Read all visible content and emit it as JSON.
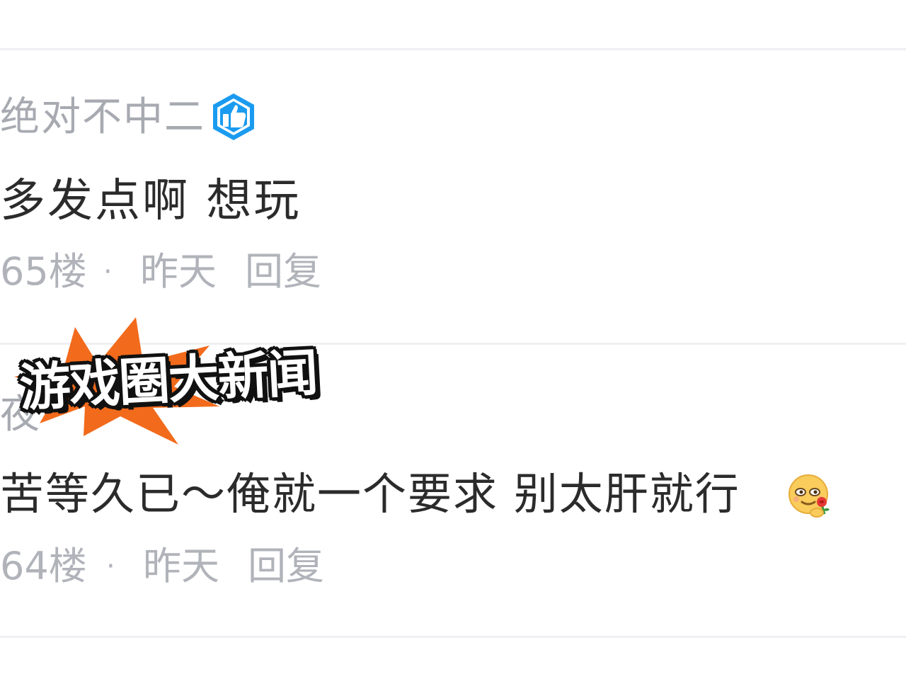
{
  "comments": [
    {
      "username": "绝对不中二",
      "badge_icon": "thumbs-up-badge-icon",
      "badge_color": "#1a9bf0",
      "content": "多发点啊 想玩",
      "floor": "65楼",
      "separator": "·",
      "time": "昨天",
      "reply_label": "回复"
    },
    {
      "username": "夜",
      "content": "苦等久已～俺就一个要求 别太肝就行",
      "emoji_icon": "smiling-face-with-rose-emoji",
      "floor": "64楼",
      "separator": "·",
      "time": "昨天",
      "reply_label": "回复"
    }
  ],
  "overlay": {
    "caption": "游戏圈大新闻",
    "burst_color": "#f26a1b"
  }
}
